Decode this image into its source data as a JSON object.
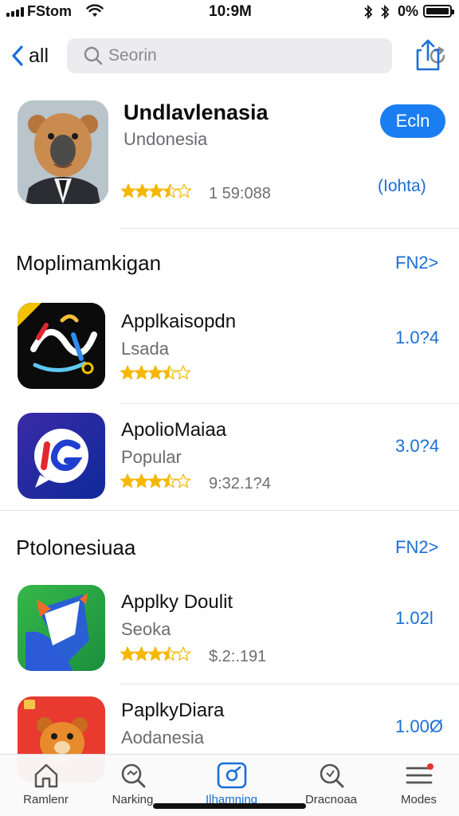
{
  "status_bar": {
    "carrier": "FStom",
    "time": "10:9M",
    "battery": "0%"
  },
  "nav": {
    "back_label": "all",
    "search_placeholder": "Seorin"
  },
  "featured": {
    "name": "Undlavlenasia",
    "subtitle": "Undonesia",
    "rating_count": "1 59:088",
    "get_label": "Ecln",
    "link_label": "(Iohta)",
    "stars": 3.5
  },
  "sections": [
    {
      "title": "Moplimamkigan",
      "more": "FN2>"
    },
    {
      "title": "Ptolonesiuaa",
      "more": "FN2>"
    }
  ],
  "apps": [
    {
      "name": "Applkaisopdn",
      "subtitle": "Lsada",
      "extra": "",
      "price": "1.0?4",
      "stars": 3.5
    },
    {
      "name": "ApolioMaiaa",
      "subtitle": "Popular",
      "extra": "9:32.1?4",
      "price": "3.0?4",
      "stars": 3.5
    },
    {
      "name": "Applky Doulit",
      "subtitle": "Seoka",
      "extra": "$.2:.191",
      "price": "1.02l",
      "stars": 3.5
    },
    {
      "name": "PaplkyDiara",
      "subtitle": "Aodanesia",
      "extra": "",
      "price": "1.00Ø",
      "stars": 0
    }
  ],
  "tabs": [
    {
      "label": "Ramlenr",
      "icon": "home-icon"
    },
    {
      "label": "Narking",
      "icon": "search-icon"
    },
    {
      "label": "Ilhamning",
      "icon": "apps-icon"
    },
    {
      "label": "Dracnoaa",
      "icon": "search-icon"
    },
    {
      "label": "Modes",
      "icon": "menu-icon"
    }
  ],
  "colors": {
    "accent": "#1a7ef2",
    "link": "#1a6fd6",
    "star": "#f5b700"
  }
}
